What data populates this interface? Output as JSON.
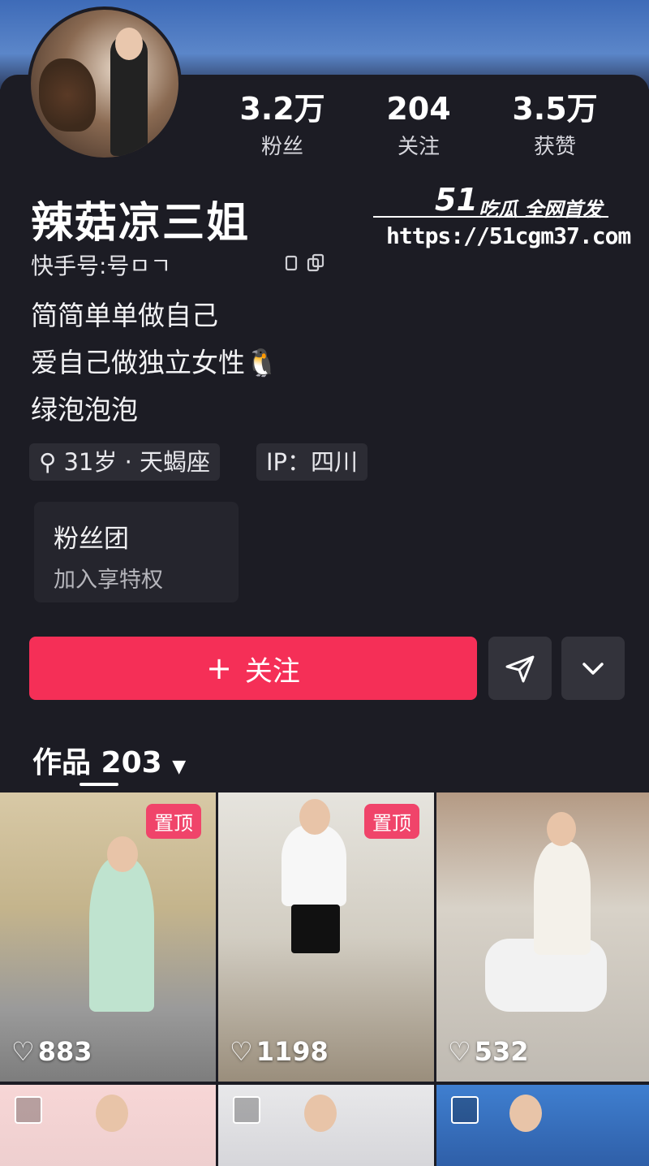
{
  "stats": [
    {
      "num": "3.2万",
      "label": "粉丝"
    },
    {
      "num": "204",
      "label": "关注"
    },
    {
      "num": "3.5万",
      "label": "获赞"
    }
  ],
  "profile": {
    "name": "辣菇凉三姐",
    "kuaishou_id": "快手号:号ㅁㄱ",
    "bio": [
      "简简单单做自己",
      "爱自己做独立女性🐧",
      "绿泡泡泡"
    ],
    "tags": [
      "31岁 · 天蝎座",
      "IP：四川"
    ]
  },
  "watermark": {
    "brand_num": "51",
    "brand_text": "吃瓜 全网首发",
    "url": "https://51cgm37.com"
  },
  "fans_club": {
    "title": "粉丝团",
    "subtitle": "加入享特权"
  },
  "actions": {
    "follow_label": "关注",
    "plus": "+"
  },
  "works": {
    "label": "作品 203"
  },
  "tiles": [
    {
      "pinned": "置顶",
      "likes": "883"
    },
    {
      "pinned": "置顶",
      "likes": "1198"
    },
    {
      "pinned": "",
      "likes": "532"
    }
  ],
  "colors": {
    "accent": "#f52f57",
    "background": "#1c1c24",
    "pin": "#f0446a"
  }
}
